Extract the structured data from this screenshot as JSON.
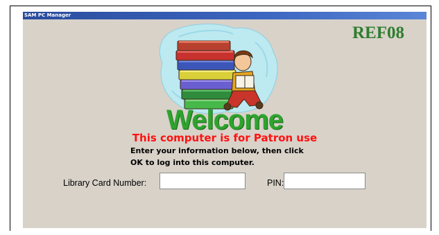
{
  "window": {
    "title": "SAM PC Manager"
  },
  "station": {
    "code": "REF08"
  },
  "welcome": {
    "heading": "Welcome",
    "notice": "This computer is for Patron use",
    "instructions_line1": "Enter your information below, then click",
    "instructions_line2": "OK to log into this computer."
  },
  "login": {
    "card_label": "Library Card Number:",
    "card_value": "",
    "pin_label": "PIN:",
    "pin_value": ""
  },
  "illustration": {
    "icon": "child-reading-books-icon"
  },
  "colors": {
    "background": "#d8d2c9",
    "welcome_green": "#2ea32e",
    "notice_red": "#ff1111",
    "station_green": "#2f7d2f"
  }
}
